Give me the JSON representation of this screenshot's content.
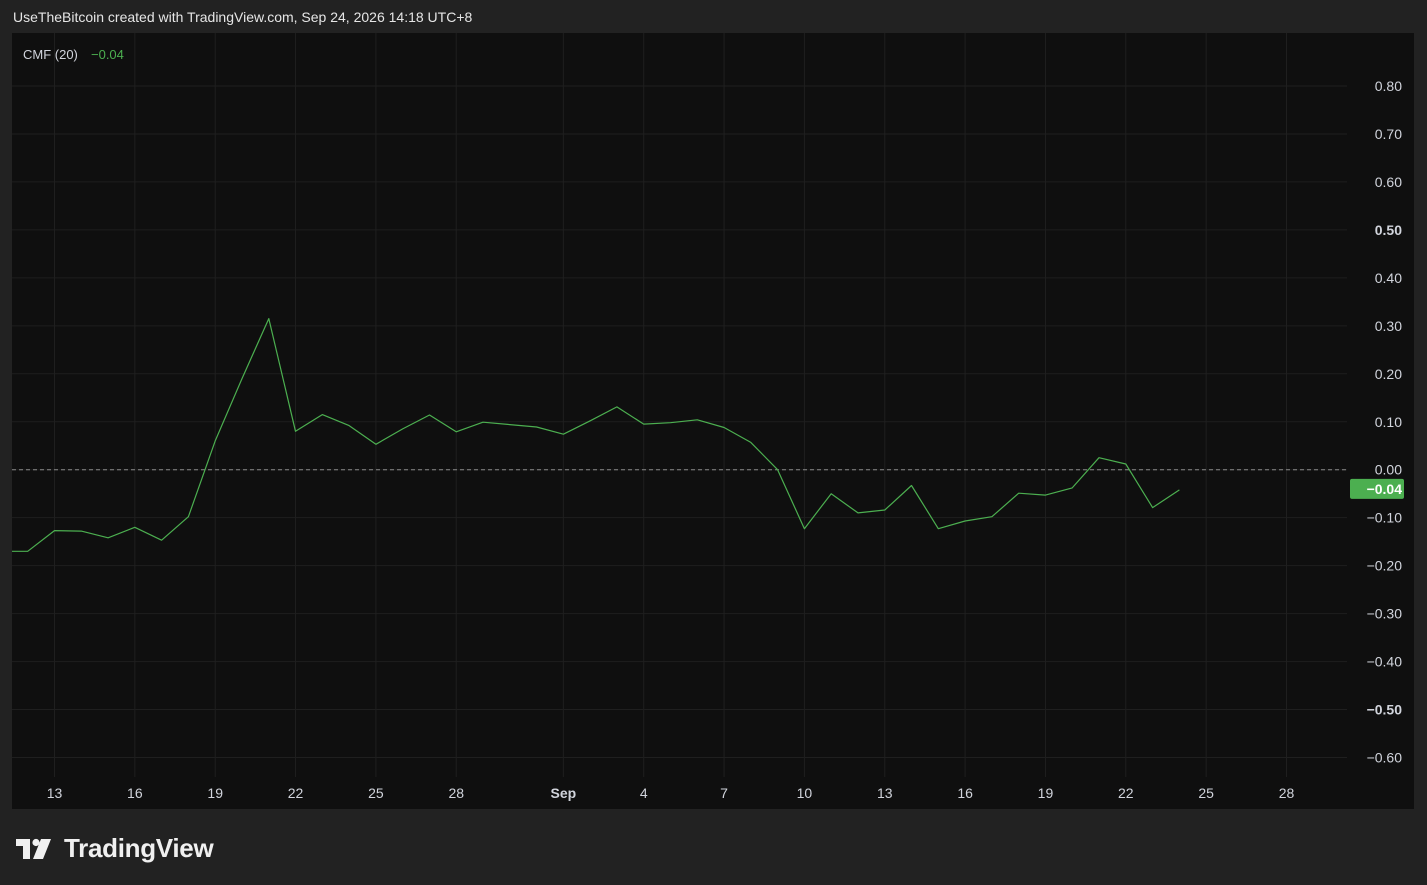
{
  "header": {
    "attribution": "UseTheBitcoin created with TradingView.com, Sep 24, 2026 14:18 UTC+8"
  },
  "legend": {
    "indicator": "CMF (20)",
    "value": "−0.04"
  },
  "footer": {
    "brand": "TradingView",
    "logo_icon": "tradingview-logo-icon"
  },
  "colors": {
    "line": "#4caf50",
    "price_label_bg": "#4caf50",
    "background": "#0f0f0f",
    "grid": "#1f1f1f",
    "text": "#d1d4dc"
  },
  "chart_data": {
    "type": "line",
    "title": "",
    "series": [
      {
        "name": "CMF (20)",
        "points": [
          {
            "x": "Aug 11",
            "y": -0.17
          },
          {
            "x": "Aug 12",
            "y": -0.17
          },
          {
            "x": "Aug 13",
            "y": -0.127
          },
          {
            "x": "Aug 14",
            "y": -0.128
          },
          {
            "x": "Aug 15",
            "y": -0.142
          },
          {
            "x": "Aug 16",
            "y": -0.12
          },
          {
            "x": "Aug 17",
            "y": -0.147
          },
          {
            "x": "Aug 18",
            "y": -0.098
          },
          {
            "x": "Aug 19",
            "y": 0.06
          },
          {
            "x": "Aug 20",
            "y": 0.19
          },
          {
            "x": "Aug 21",
            "y": 0.315
          },
          {
            "x": "Aug 22",
            "y": 0.08
          },
          {
            "x": "Aug 23",
            "y": 0.115
          },
          {
            "x": "Aug 24",
            "y": 0.092
          },
          {
            "x": "Aug 25",
            "y": 0.053
          },
          {
            "x": "Aug 26",
            "y": 0.085
          },
          {
            "x": "Aug 27",
            "y": 0.114
          },
          {
            "x": "Aug 28",
            "y": 0.079
          },
          {
            "x": "Aug 29",
            "y": 0.099
          },
          {
            "x": "Aug 30",
            "y": 0.094
          },
          {
            "x": "Aug 31",
            "y": 0.089
          },
          {
            "x": "Sep 1",
            "y": 0.074
          },
          {
            "x": "Sep 2",
            "y": 0.102
          },
          {
            "x": "Sep 3",
            "y": 0.131
          },
          {
            "x": "Sep 4",
            "y": 0.095
          },
          {
            "x": "Sep 5",
            "y": 0.098
          },
          {
            "x": "Sep 6",
            "y": 0.104
          },
          {
            "x": "Sep 7",
            "y": 0.088
          },
          {
            "x": "Sep 8",
            "y": 0.057
          },
          {
            "x": "Sep 9",
            "y": 0.0
          },
          {
            "x": "Sep 10",
            "y": -0.123
          },
          {
            "x": "Sep 11",
            "y": -0.05
          },
          {
            "x": "Sep 12",
            "y": -0.09
          },
          {
            "x": "Sep 13",
            "y": -0.084
          },
          {
            "x": "Sep 14",
            "y": -0.033
          },
          {
            "x": "Sep 15",
            "y": -0.123
          },
          {
            "x": "Sep 16",
            "y": -0.107
          },
          {
            "x": "Sep 17",
            "y": -0.098
          },
          {
            "x": "Sep 18",
            "y": -0.049
          },
          {
            "x": "Sep 19",
            "y": -0.053
          },
          {
            "x": "Sep 20",
            "y": -0.038
          },
          {
            "x": "Sep 21",
            "y": 0.025
          },
          {
            "x": "Sep 22",
            "y": 0.012
          },
          {
            "x": "Sep 23",
            "y": -0.079
          },
          {
            "x": "Sep 24",
            "y": -0.042
          }
        ]
      }
    ],
    "x_range": [
      "Aug 10",
      "Sep 29"
    ],
    "x_ticks": [
      {
        "label": "13",
        "x": "Aug 13"
      },
      {
        "label": "16",
        "x": "Aug 16"
      },
      {
        "label": "19",
        "x": "Aug 19"
      },
      {
        "label": "22",
        "x": "Aug 22"
      },
      {
        "label": "25",
        "x": "Aug 25"
      },
      {
        "label": "28",
        "x": "Aug 28"
      },
      {
        "label": "Sep",
        "x": "Sep 1",
        "bold": true
      },
      {
        "label": "4",
        "x": "Sep 4"
      },
      {
        "label": "7",
        "x": "Sep 7"
      },
      {
        "label": "10",
        "x": "Sep 10"
      },
      {
        "label": "13",
        "x": "Sep 13"
      },
      {
        "label": "16",
        "x": "Sep 16"
      },
      {
        "label": "19",
        "x": "Sep 19"
      },
      {
        "label": "22",
        "x": "Sep 22"
      },
      {
        "label": "25",
        "x": "Sep 25"
      },
      {
        "label": "28",
        "x": "Sep 28"
      }
    ],
    "y_ticks": [
      {
        "label": "0.80",
        "value": 0.8
      },
      {
        "label": "0.70",
        "value": 0.7
      },
      {
        "label": "0.60",
        "value": 0.6
      },
      {
        "label": "0.50",
        "value": 0.5,
        "bold": true
      },
      {
        "label": "0.40",
        "value": 0.4
      },
      {
        "label": "0.30",
        "value": 0.3
      },
      {
        "label": "0.20",
        "value": 0.2
      },
      {
        "label": "0.10",
        "value": 0.1
      },
      {
        "label": "0.00",
        "value": 0.0
      },
      {
        "label": "−0.10",
        "value": -0.1
      },
      {
        "label": "−0.20",
        "value": -0.2
      },
      {
        "label": "−0.30",
        "value": -0.3
      },
      {
        "label": "−0.40",
        "value": -0.4
      },
      {
        "label": "−0.50",
        "value": -0.5,
        "bold": true
      },
      {
        "label": "−0.60",
        "value": -0.6
      }
    ],
    "ylim": [
      -0.6,
      0.8
    ],
    "zero_line": true,
    "last_value_label": "−0.04",
    "last_value": -0.04,
    "grid": true
  }
}
